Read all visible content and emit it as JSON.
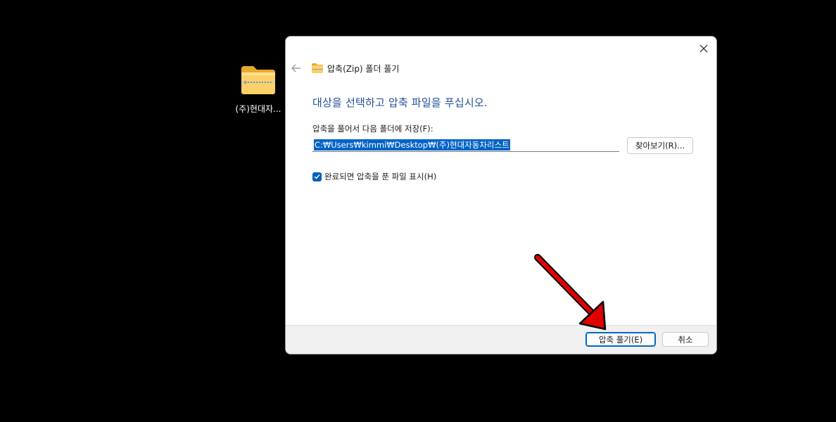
{
  "desktop": {
    "icon_label": "(주)현대자...",
    "icon": "zip-folder-icon"
  },
  "dialog": {
    "title": "압축(Zip) 폴더 풀기",
    "instruction": "대상을 선택하고 압축 파일을 푸십시오.",
    "field_label": "압축을 풀어서 다음 폴더에 저장(F):",
    "path_value": "C:₩Users₩kimmi₩Desktop₩(주)현대자동차리스트",
    "browse_label": "찾아보기(R)...",
    "checkbox_label": "완료되면 압축을 푼 파일 표시(H)",
    "checkbox_checked": true,
    "extract_label": "압축 풀기(E)",
    "cancel_label": "취소",
    "icons": [
      "back-arrow-icon",
      "zip-folder-icon",
      "close-icon",
      "checkmark-icon"
    ]
  },
  "colors": {
    "instruction": "#1f4e99",
    "accent": "#005fb8",
    "annotation_arrow": "#e00000"
  }
}
